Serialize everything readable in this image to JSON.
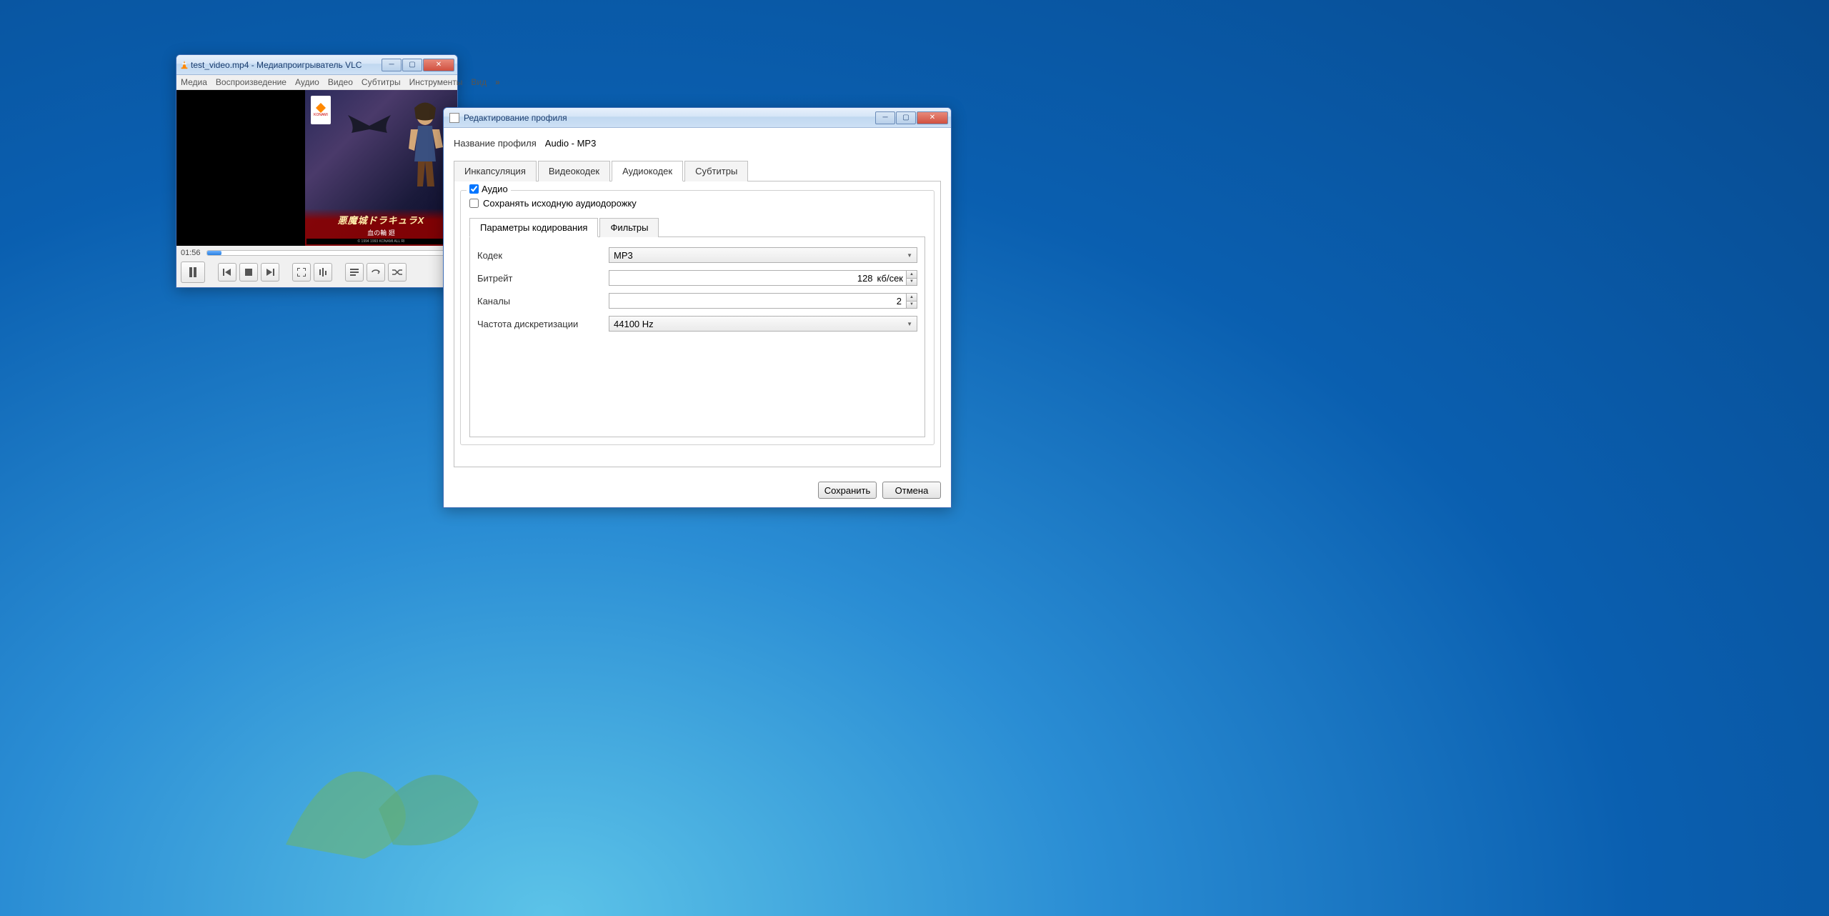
{
  "vlc": {
    "title": "test_video.mp4 - Медиапроигрыватель VLC",
    "menu": {
      "media": "Медиа",
      "playback": "Воспроизведение",
      "audio": "Аудио",
      "video": "Видео",
      "subtitle": "Субтитры",
      "tools": "Инструменты",
      "view": "Вид",
      "overflow": "»"
    },
    "video_art": {
      "logo": "KONAMI",
      "jp_line1": "悪魔城ドラキュラX",
      "jp_line2": "血の輪 廻",
      "jp_line3": "© 1994 1993 KONAMI  ALL RI"
    },
    "time": "01:56"
  },
  "dialog": {
    "title": "Редактирование профиля",
    "profile_label": "Название профиля",
    "profile_value": "Audio - MP3",
    "tabs": {
      "encap": "Инкапсуляция",
      "vcodec": "Видеокодек",
      "acodec": "Аудиокодек",
      "subs": "Субтитры"
    },
    "audio_checkbox": "Аудио",
    "keep_original": "Сохранять исходную аудиодорожку",
    "subtabs": {
      "encoding": "Параметры кодирования",
      "filters": "Фильтры"
    },
    "fields": {
      "codec_label": "Кодек",
      "codec_value": "MP3",
      "bitrate_label": "Битрейт",
      "bitrate_value": "128",
      "bitrate_unit": "кб/сек",
      "channels_label": "Каналы",
      "channels_value": "2",
      "samplerate_label": "Частота дискретизации",
      "samplerate_value": "44100 Hz"
    },
    "buttons": {
      "save": "Сохранить",
      "cancel": "Отмена"
    }
  }
}
